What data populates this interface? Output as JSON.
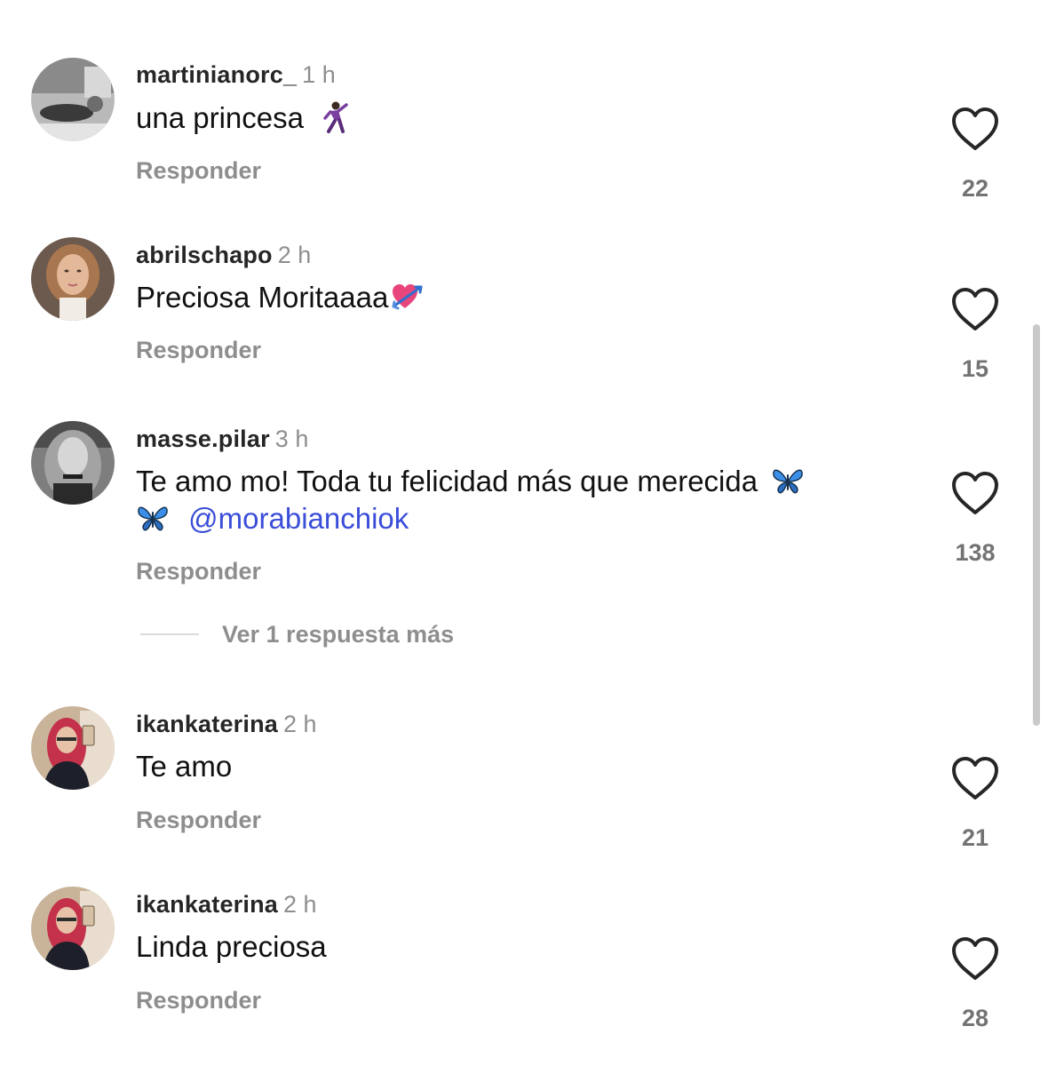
{
  "comments": [
    {
      "username": "martinianorc_",
      "time": "1 h",
      "text": "una princesa",
      "emoji": "dancing-man-emoji",
      "reply_label": "Responder",
      "likes": "22"
    },
    {
      "username": "abrilschapo",
      "time": "2 h",
      "text": "Preciosa Moritaaaa",
      "emoji": "heart-with-arrow-emoji",
      "reply_label": "Responder",
      "likes": "15"
    },
    {
      "username": "masse.pilar",
      "time": "3 h",
      "text_line1": "Te amo mo! Toda tu felicidad más que merecida",
      "emoji": "butterfly-emoji",
      "mention": "@morabianchiok",
      "reply_label": "Responder",
      "likes": "138",
      "more_replies": "Ver 1 respuesta más"
    },
    {
      "username": "ikankaterina",
      "time": "2 h",
      "text": "Te amo",
      "reply_label": "Responder",
      "likes": "21"
    },
    {
      "username": "ikankaterina",
      "time": "2 h",
      "text": "Linda preciosa",
      "reply_label": "Responder",
      "likes": "28"
    }
  ],
  "colors": {
    "username": "#262626",
    "secondary": "#8e8e8e",
    "mention": "#3b4ed8",
    "like_count": "#737373"
  },
  "icons": {
    "like": "heart-outline-icon"
  }
}
